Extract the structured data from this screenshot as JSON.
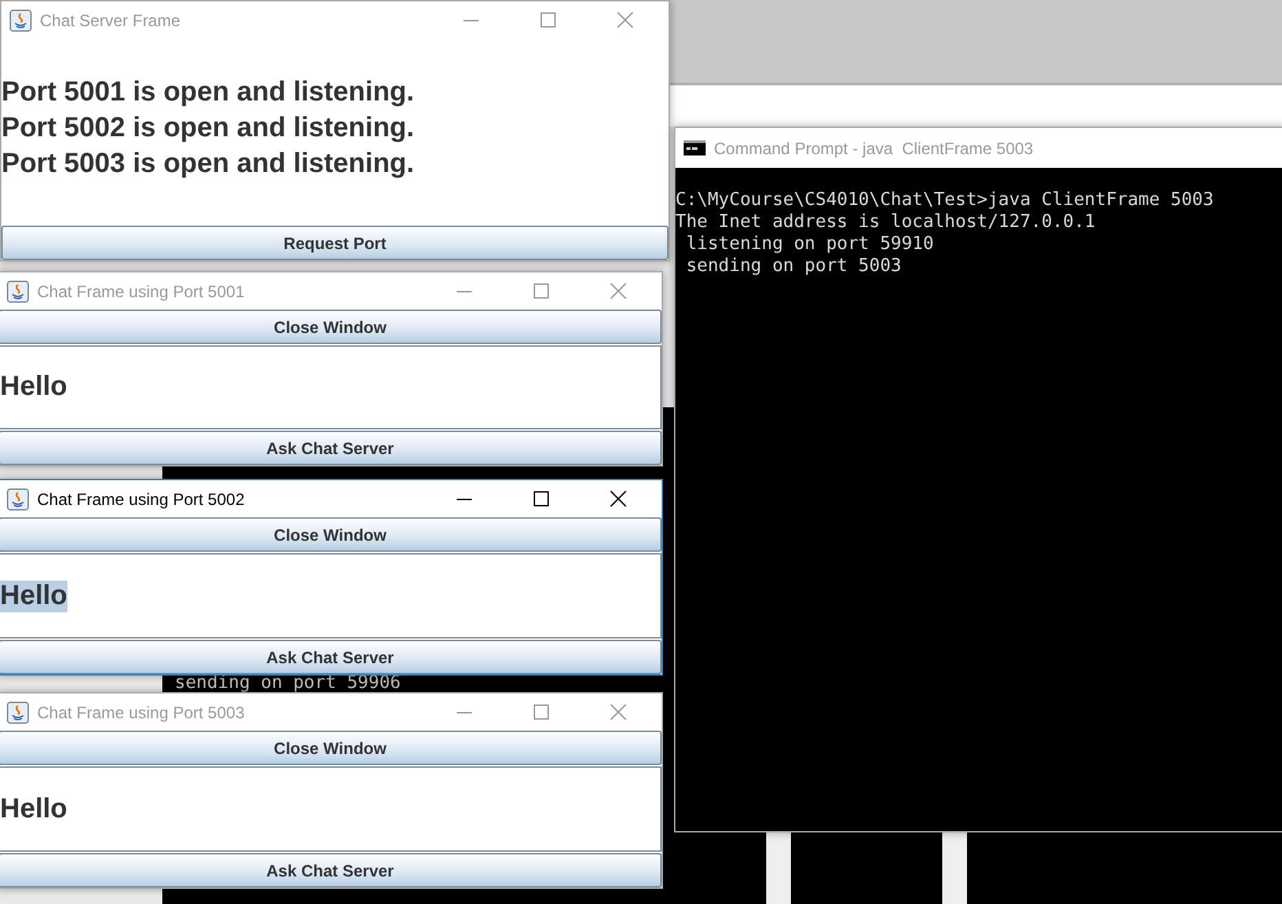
{
  "background_console": {
    "lines": [
      "sending on port 59906"
    ]
  },
  "windows": [
    {
      "kind": "server",
      "title": "Chat Server Frame",
      "active": false,
      "lines": [
        "Port 5001 is open and listening.",
        "Port 5002 is open and listening.",
        "Port 5003 is open and listening."
      ],
      "button": "Request Port"
    },
    {
      "kind": "chat",
      "title": "Chat Frame using Port 5001",
      "active": false,
      "top_button": "Close Window",
      "message": "Hello",
      "message_selected": false,
      "bottom_button": "Ask Chat Server"
    },
    {
      "kind": "chat",
      "title": "Chat Frame using Port 5002",
      "active": true,
      "top_button": "Close Window",
      "message": "Hello",
      "message_selected": true,
      "bottom_button": "Ask Chat Server"
    },
    {
      "kind": "chat",
      "title": "Chat Frame using Port 5003",
      "active": false,
      "top_button": "Close Window",
      "message": "Hello",
      "message_selected": false,
      "bottom_button": "Ask Chat Server"
    },
    {
      "kind": "console",
      "title": "Command Prompt - java  ClientFrame 5003",
      "active": false,
      "lines": [
        "C:\\MyCourse\\CS4010\\Chat\\Test>java ClientFrame 5003",
        "The Inet address is localhost/127.0.0.1",
        " listening on port 59910",
        " sending on port 5003"
      ]
    }
  ]
}
